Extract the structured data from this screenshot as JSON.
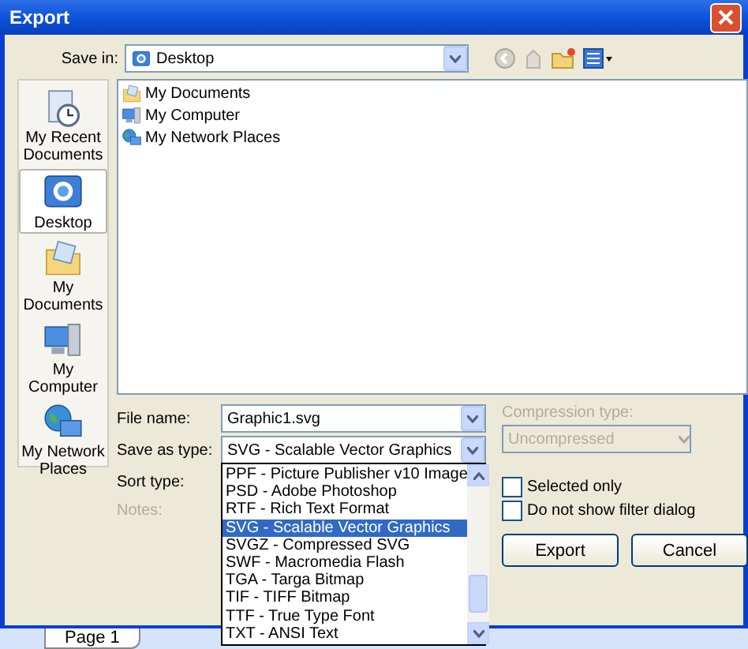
{
  "window": {
    "title": "Export"
  },
  "save_in": {
    "label": "Save in:",
    "value": "Desktop"
  },
  "places": [
    {
      "label": "My Recent Documents",
      "selected": false
    },
    {
      "label": "Desktop",
      "selected": true
    },
    {
      "label": "My Documents",
      "selected": false
    },
    {
      "label": "My Computer",
      "selected": false
    },
    {
      "label": "My Network Places",
      "selected": false
    }
  ],
  "files": [
    "My Documents",
    "My Computer",
    "My Network Places"
  ],
  "file_name": {
    "label": "File name:",
    "value": "Graphic1.svg"
  },
  "save_as_type": {
    "label": "Save as type:",
    "value": "SVG - Scalable Vector Graphics",
    "expanded": true,
    "options": [
      {
        "label": "PPF - Picture Publisher v10 Image",
        "selected": false
      },
      {
        "label": "PSD - Adobe Photoshop",
        "selected": false
      },
      {
        "label": "RTF - Rich Text Format",
        "selected": false
      },
      {
        "label": "SVG - Scalable Vector Graphics",
        "selected": true
      },
      {
        "label": "SVGZ - Compressed SVG",
        "selected": false
      },
      {
        "label": "SWF - Macromedia Flash",
        "selected": false
      },
      {
        "label": "TGA - Targa Bitmap",
        "selected": false
      },
      {
        "label": "TIF - TIFF Bitmap",
        "selected": false
      },
      {
        "label": "TTF - True Type Font",
        "selected": false
      },
      {
        "label": "TXT - ANSI Text",
        "selected": false
      }
    ]
  },
  "sort_type": {
    "label": "Sort type:"
  },
  "notes": {
    "label": "Notes:",
    "disabled": true
  },
  "compression": {
    "label": "Compression type:",
    "value": "Uncompressed",
    "disabled": true
  },
  "checkboxes": [
    {
      "label": "Selected only",
      "checked": false
    },
    {
      "label": "Do not show filter dialog",
      "checked": false
    }
  ],
  "buttons": [
    "Export",
    "Cancel"
  ],
  "page_tab": {
    "label": "Page 1"
  }
}
